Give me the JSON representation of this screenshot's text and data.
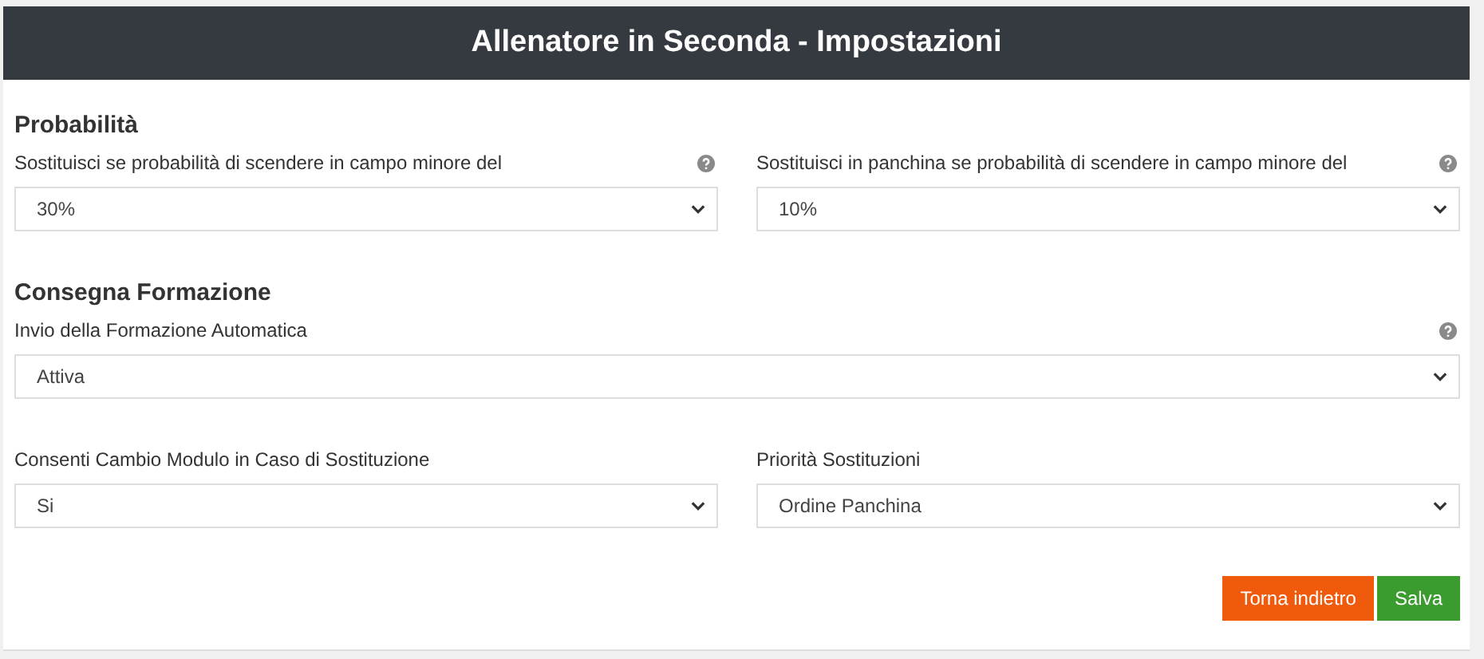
{
  "header": {
    "title": "Allenatore in Seconda - Impostazioni"
  },
  "sections": [
    {
      "title": "Probabilità",
      "rows": [
        [
          {
            "label": "Sostituisci se probabilità di scendere in campo minore del",
            "value": "30%",
            "help": true
          },
          {
            "label": "Sostituisci in panchina se probabilità di scendere in campo minore del",
            "value": "10%",
            "help": true
          }
        ]
      ]
    },
    {
      "title": "Consegna Formazione",
      "rows": [
        [
          {
            "label": "Invio della Formazione Automatica",
            "value": "Attiva",
            "help": true
          }
        ],
        [
          {
            "label": "Consenti Cambio Modulo in Caso di Sostituzione",
            "value": "Si",
            "help": false
          },
          {
            "label": "Priorità Sostituzioni",
            "value": "Ordine Panchina",
            "help": false
          }
        ]
      ]
    }
  ],
  "buttons": [
    {
      "label": "Torna indietro",
      "kind": "back"
    },
    {
      "label": "Salva",
      "kind": "save"
    }
  ]
}
